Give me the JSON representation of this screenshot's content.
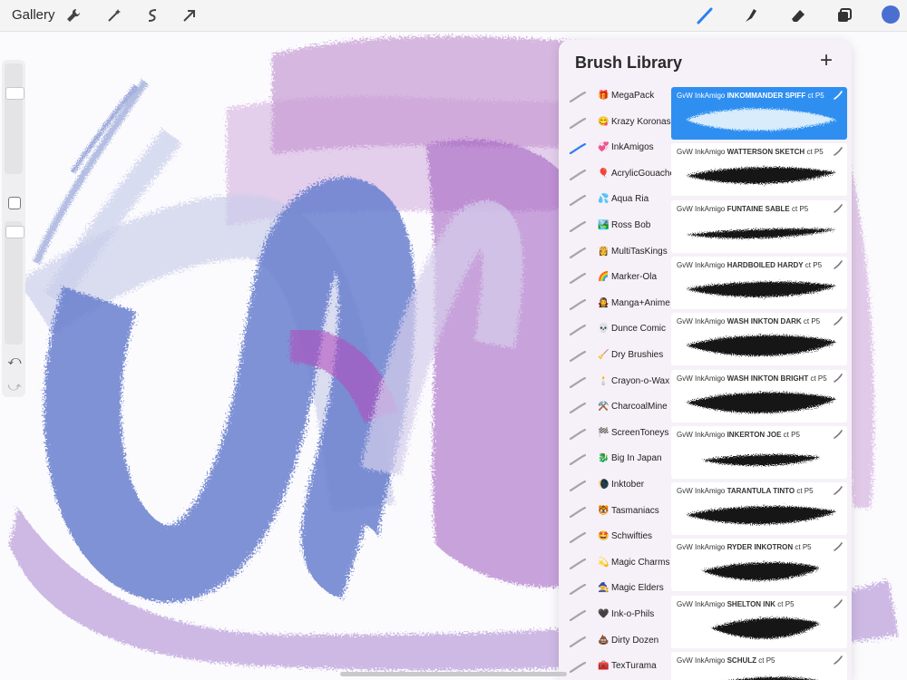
{
  "toolbar": {
    "gallery_label": "Gallery",
    "icons": [
      "wrench-icon",
      "magic-wand-icon",
      "selection-s-icon",
      "arrow-transform-icon"
    ],
    "tools": [
      "brush-tool-icon",
      "smudge-tool-icon",
      "eraser-tool-icon",
      "layers-icon"
    ],
    "current_color": "#4a6fd0",
    "active_tool_color": "#2f7ff0"
  },
  "brush_library": {
    "title": "Brush Library",
    "add_symbol": "+",
    "sets": [
      {
        "emoji": "🎁",
        "label": "MegaPack"
      },
      {
        "emoji": "😋",
        "label": "Krazy Koronas"
      },
      {
        "emoji": "💞",
        "label": "InkAmigos",
        "selected": true
      },
      {
        "emoji": "🎈",
        "label": "AcrylicGouache"
      },
      {
        "emoji": "💦",
        "label": "Aqua Ria"
      },
      {
        "emoji": "🏞️",
        "label": "Ross Bob"
      },
      {
        "emoji": "👸",
        "label": "MultiTasKings"
      },
      {
        "emoji": "🌈",
        "label": "Marker-Ola"
      },
      {
        "emoji": "🧛‍♀️",
        "label": "Manga+Anime"
      },
      {
        "emoji": "💀",
        "label": "Dunce Comic"
      },
      {
        "emoji": "🧹",
        "label": "Dry Brushies"
      },
      {
        "emoji": "🕯️",
        "label": "Crayon-o-Wax"
      },
      {
        "emoji": "⚒️",
        "label": "CharcoalMine"
      },
      {
        "emoji": "🏁",
        "label": "ScreenToneys"
      },
      {
        "emoji": "🐉",
        "label": "Big In Japan"
      },
      {
        "emoji": "🌘",
        "label": "Inktober"
      },
      {
        "emoji": "🐯",
        "label": "Tasmaniacs"
      },
      {
        "emoji": "🤩",
        "label": "Schwifties"
      },
      {
        "emoji": "💫",
        "label": "Magic Charms"
      },
      {
        "emoji": "🧙",
        "label": "Magic Elders"
      },
      {
        "emoji": "🖤",
        "label": "Ink-o-Phils"
      },
      {
        "emoji": "💩",
        "label": "Dirty Dozen"
      },
      {
        "emoji": "🧰",
        "label": "TexTurama"
      }
    ],
    "brushes": [
      {
        "prefix": "GvW InkAmigo ",
        "name": "INKOMMANDER SPIFF",
        "suffix": " ct P5",
        "selected": true
      },
      {
        "prefix": "GvW InkAmigo ",
        "name": "WATTERSON SKETCH",
        "suffix": " ct P5"
      },
      {
        "prefix": "GvW InkAmigo ",
        "name": "FUNTAINE SABLE",
        "suffix": " ct P5"
      },
      {
        "prefix": "GvW InkAmigo ",
        "name": "HARDBOILED HARDY",
        "suffix": " ct P5"
      },
      {
        "prefix": "GvW InkAmigo ",
        "name": "WASH INKTON DARK",
        "suffix": " ct P5"
      },
      {
        "prefix": "GvW InkAmigo ",
        "name": "WASH INKTON BRIGHT",
        "suffix": " ct P5"
      },
      {
        "prefix": "GvW InkAmigo ",
        "name": "INKERTON JOE",
        "suffix": " ct P5"
      },
      {
        "prefix": "GvW InkAmigo ",
        "name": "TARANTULA TINTO",
        "suffix": " ct P5"
      },
      {
        "prefix": "GvW InkAmigo ",
        "name": "RYDER INKOTRON",
        "suffix": " ct P5"
      },
      {
        "prefix": "GvW InkAmigo ",
        "name": "SHELTON INK",
        "suffix": " ct P5"
      },
      {
        "prefix": "GvW InkAmigo ",
        "name": "SCHULZ",
        "suffix": " ct P5"
      }
    ]
  },
  "sidebar": {
    "brush_size_level": 0.76,
    "opacity_level": 0.96,
    "undo_symbol": "⤺",
    "redo_symbol": "⤻"
  }
}
